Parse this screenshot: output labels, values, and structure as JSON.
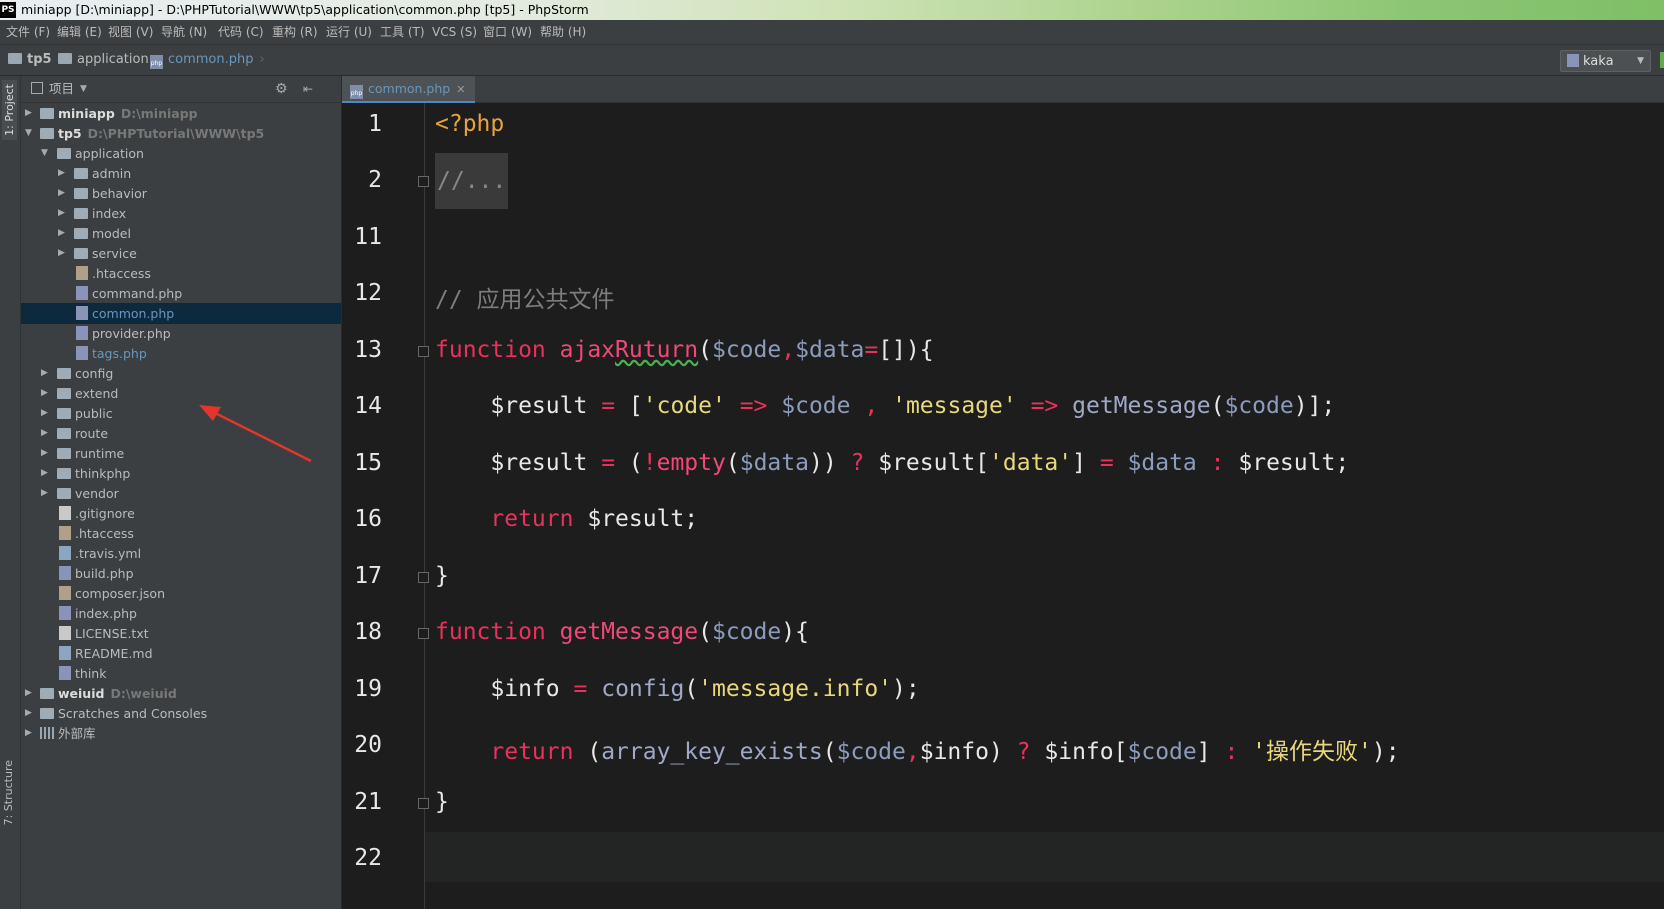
{
  "window": {
    "title": "miniapp [D:\\miniapp] - D:\\PHPTutorial\\WWW\\tp5\\application\\common.php [tp5] - PhpStorm",
    "app_badge": "PS"
  },
  "menu": [
    "文件 (F)",
    "编辑 (E)",
    "视图 (V)",
    "导航 (N)",
    "代码 (C)",
    "重构 (R)",
    "运行 (U)",
    "工具 (T)",
    "VCS (S)",
    "窗口 (W)",
    "帮助 (H)"
  ],
  "breadcrumb": [
    "tp5",
    "application",
    "common.php"
  ],
  "run_config": "kaka",
  "side_tabs": {
    "project": "1: Project",
    "structure": "7: Structure"
  },
  "project_panel": {
    "title": "项目"
  },
  "tree": [
    {
      "label": "miniapp",
      "path": "D:\\miniapp"
    },
    {
      "label": "tp5",
      "path": "D:\\PHPTutorial\\WWW\\tp5"
    },
    {
      "label": "application"
    },
    {
      "label": "admin"
    },
    {
      "label": "behavior"
    },
    {
      "label": "index"
    },
    {
      "label": "model"
    },
    {
      "label": "service"
    },
    {
      "label": ".htaccess"
    },
    {
      "label": "command.php"
    },
    {
      "label": "common.php"
    },
    {
      "label": "provider.php"
    },
    {
      "label": "tags.php"
    },
    {
      "label": "config"
    },
    {
      "label": "extend"
    },
    {
      "label": "public"
    },
    {
      "label": "route"
    },
    {
      "label": "runtime"
    },
    {
      "label": "thinkphp"
    },
    {
      "label": "vendor"
    },
    {
      "label": ".gitignore"
    },
    {
      "label": ".htaccess"
    },
    {
      "label": ".travis.yml"
    },
    {
      "label": "build.php"
    },
    {
      "label": "composer.json"
    },
    {
      "label": "index.php"
    },
    {
      "label": "LICENSE.txt"
    },
    {
      "label": "README.md"
    },
    {
      "label": "think"
    },
    {
      "label": "weiuid",
      "path": "D:\\weiuid"
    },
    {
      "label": "Scratches and Consoles"
    },
    {
      "label": "外部库"
    }
  ],
  "editor": {
    "tab": "common.php",
    "line_numbers": [
      "1",
      "2",
      "11",
      "12",
      "13",
      "14",
      "15",
      "16",
      "17",
      "18",
      "19",
      "20",
      "21",
      "22"
    ],
    "comment": "// 应用公共文件",
    "error_message": "'操作失败'"
  }
}
